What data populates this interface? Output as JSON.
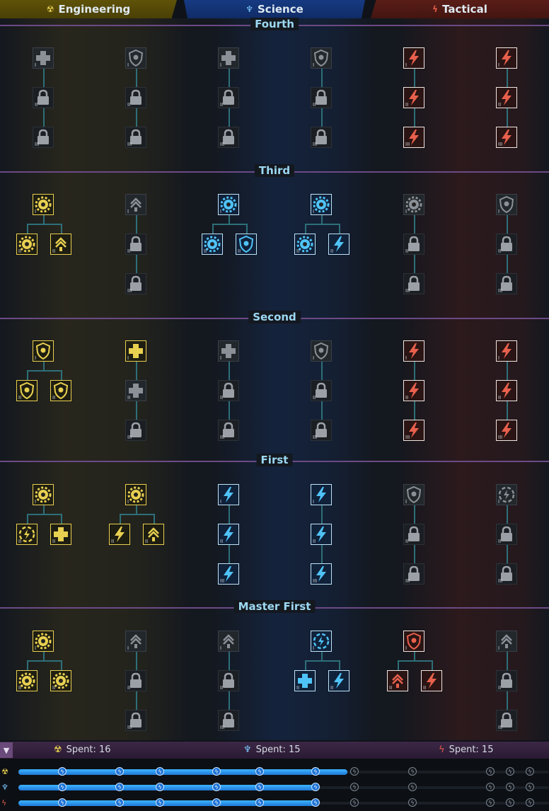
{
  "tabs": [
    {
      "label": "Engineering",
      "icon": "engineering-icon",
      "color": "#e8d050"
    },
    {
      "label": "Science",
      "icon": "science-icon",
      "color": "#7cc8ff"
    },
    {
      "label": "Tactical",
      "icon": "tactical-icon",
      "color": "#e05a4a"
    }
  ],
  "tiers": [
    "Fourth",
    "Third",
    "Second",
    "First",
    "Master First"
  ],
  "rank_labels": [
    "I",
    "II",
    "III"
  ],
  "spent": [
    {
      "label": "Spent: 16",
      "icon": "engineering-icon"
    },
    {
      "label": "Spent: 15",
      "icon": "science-icon"
    },
    {
      "label": "Spent: 15",
      "icon": "tactical-icon"
    }
  ],
  "progress": {
    "engineering_fraction": 0.62,
    "science_fraction": 0.56,
    "tactical_fraction": 0.56
  },
  "colors": {
    "engineering": "#e8d050",
    "science": "#3db4ff",
    "tactical": "#e05a4a",
    "tier_line": "#6c4a86",
    "connector": "#2d6f79"
  }
}
